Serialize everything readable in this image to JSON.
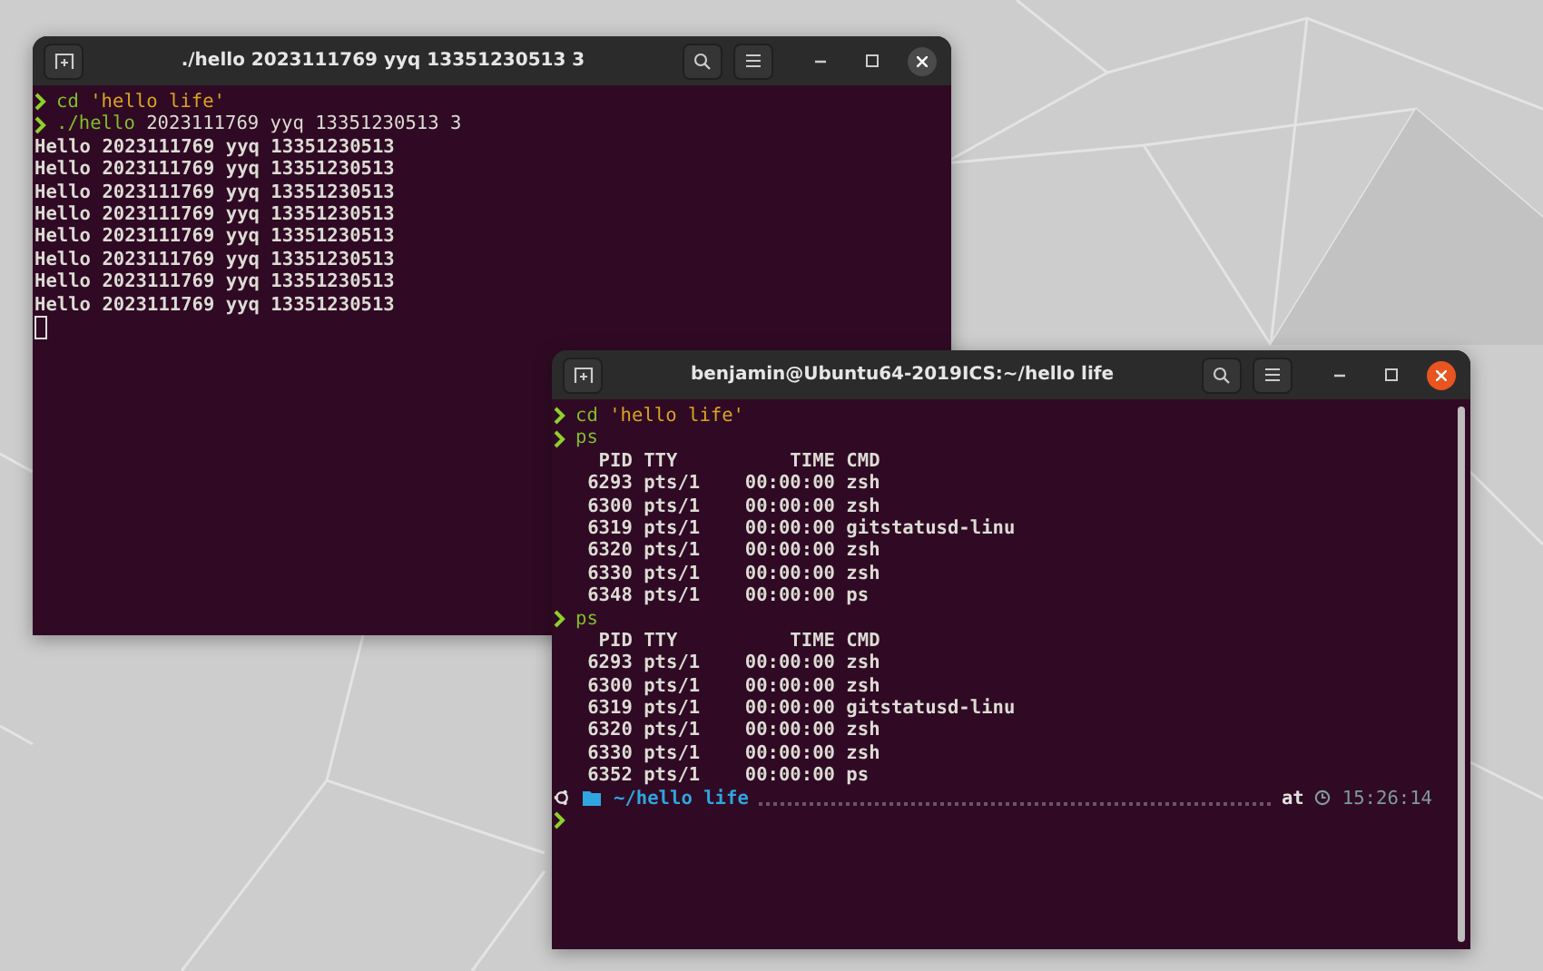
{
  "windows": [
    {
      "title": "./hello 2023111769 yyq 13351230513 3",
      "focused": false,
      "scrollbar": false,
      "cursor": true,
      "lines": [
        {
          "kind": "prompt",
          "parts": [
            {
              "kind": "command",
              "text": "cd"
            },
            {
              "kind": "string",
              "text": "'hello life'"
            }
          ]
        },
        {
          "kind": "prompt",
          "parts": [
            {
              "kind": "command",
              "text": "./hello"
            },
            {
              "kind": "arg",
              "text": " 2023111769 yyq 13351230513 3"
            }
          ]
        },
        {
          "kind": "output",
          "text": "Hello 2023111769 yyq 13351230513"
        },
        {
          "kind": "output",
          "text": "Hello 2023111769 yyq 13351230513"
        },
        {
          "kind": "output",
          "text": "Hello 2023111769 yyq 13351230513"
        },
        {
          "kind": "output",
          "text": "Hello 2023111769 yyq 13351230513"
        },
        {
          "kind": "output",
          "text": "Hello 2023111769 yyq 13351230513"
        },
        {
          "kind": "output",
          "text": "Hello 2023111769 yyq 13351230513"
        },
        {
          "kind": "output",
          "text": "Hello 2023111769 yyq 13351230513"
        },
        {
          "kind": "output",
          "text": "Hello 2023111769 yyq 13351230513"
        }
      ]
    },
    {
      "title": "benjamin@Ubuntu64-2019ICS:~/hello life",
      "focused": true,
      "scrollbar": true,
      "cursor": false,
      "lines": [
        {
          "kind": "prompt",
          "parts": [
            {
              "kind": "command",
              "text": "cd"
            },
            {
              "kind": "string",
              "text": "'hello life'"
            }
          ]
        },
        {
          "kind": "prompt",
          "parts": [
            {
              "kind": "command",
              "text": "ps"
            }
          ]
        },
        {
          "kind": "output",
          "text": "    PID TTY          TIME CMD"
        },
        {
          "kind": "output",
          "text": "   6293 pts/1    00:00:00 zsh"
        },
        {
          "kind": "output",
          "text": "   6300 pts/1    00:00:00 zsh"
        },
        {
          "kind": "output",
          "text": "   6319 pts/1    00:00:00 gitstatusd-linu"
        },
        {
          "kind": "output",
          "text": "   6320 pts/1    00:00:00 zsh"
        },
        {
          "kind": "output",
          "text": "   6330 pts/1    00:00:00 zsh"
        },
        {
          "kind": "output",
          "text": "   6348 pts/1    00:00:00 ps"
        },
        {
          "kind": "prompt",
          "parts": [
            {
              "kind": "command",
              "text": "ps"
            }
          ]
        },
        {
          "kind": "output",
          "text": "    PID TTY          TIME CMD"
        },
        {
          "kind": "output",
          "text": "   6293 pts/1    00:00:00 zsh"
        },
        {
          "kind": "output",
          "text": "   6300 pts/1    00:00:00 zsh"
        },
        {
          "kind": "output",
          "text": "   6319 pts/1    00:00:00 gitstatusd-linu"
        },
        {
          "kind": "output",
          "text": "   6320 pts/1    00:00:00 zsh"
        },
        {
          "kind": "output",
          "text": "   6330 pts/1    00:00:00 zsh"
        },
        {
          "kind": "output",
          "text": "   6352 pts/1    00:00:00 ps"
        },
        {
          "kind": "status",
          "path": "~/hello life",
          "at": "at",
          "time": "15:26:14"
        },
        {
          "kind": "prompt"
        }
      ]
    }
  ]
}
